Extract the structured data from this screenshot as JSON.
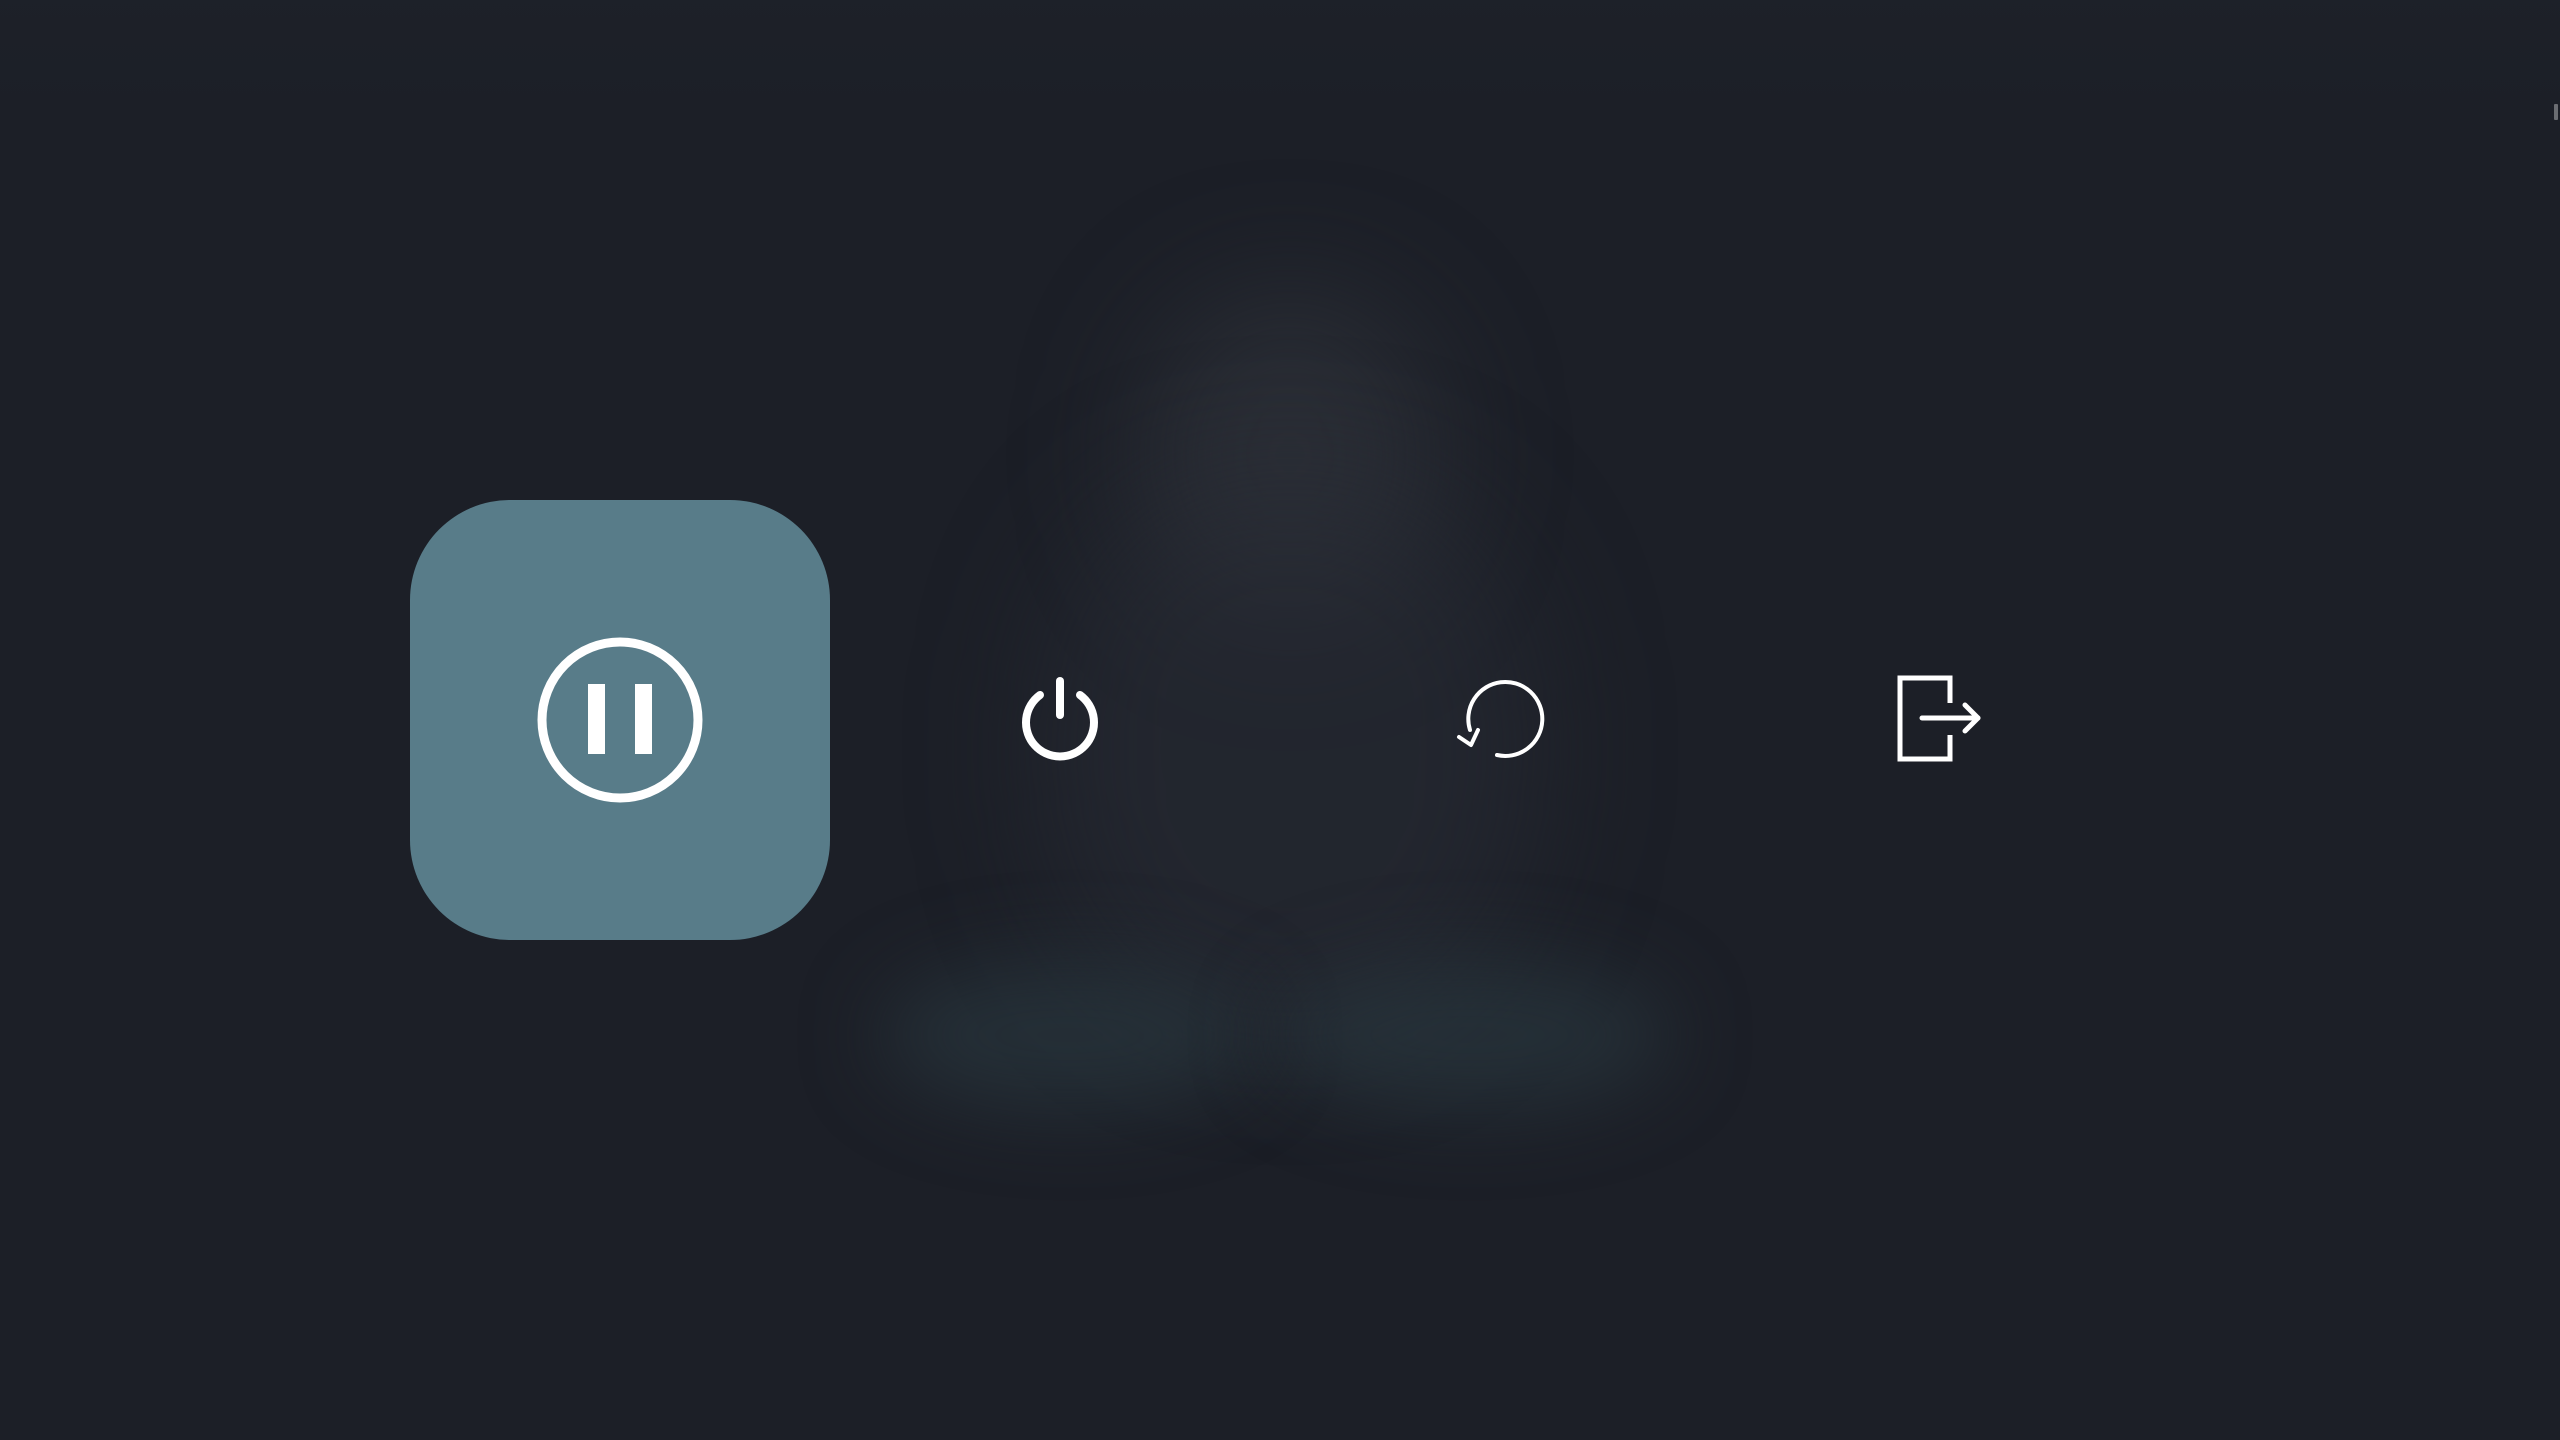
{
  "power_menu": {
    "selected": "suspend",
    "accent_color": "#587c89",
    "background_color": "#1c1f27",
    "icon_color": "#ffffff",
    "options": [
      {
        "id": "suspend",
        "icon": "pause-circle-icon",
        "selected": true
      },
      {
        "id": "poweroff",
        "icon": "power-icon",
        "selected": false
      },
      {
        "id": "restart",
        "icon": "restart-icon",
        "selected": false
      },
      {
        "id": "logout",
        "icon": "logout-icon",
        "selected": false
      }
    ]
  }
}
